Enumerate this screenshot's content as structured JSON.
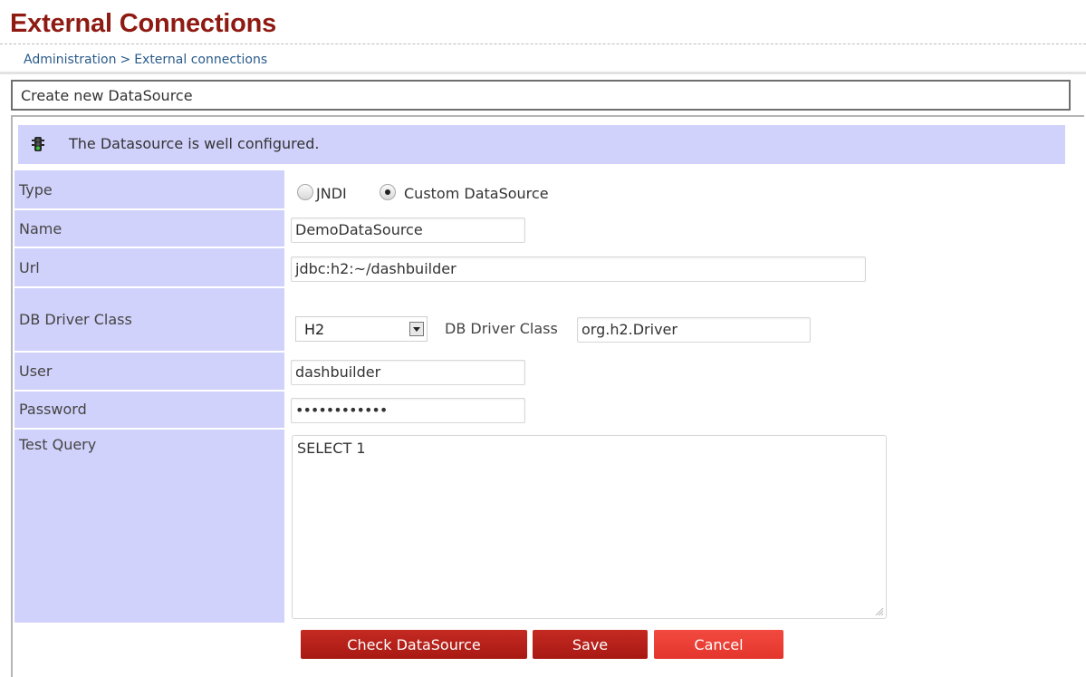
{
  "header": {
    "title": "External Connections"
  },
  "breadcrumb": {
    "items": [
      "Administration",
      "External connections"
    ],
    "separator": ">"
  },
  "section": {
    "title": "Create new DataSource"
  },
  "status": {
    "message": "The Datasource is well configured.",
    "icon": "traffic-light-icon",
    "color": "#d1d2fb"
  },
  "form": {
    "type": {
      "label": "Type",
      "options": [
        "JNDI",
        "Custom DataSource"
      ],
      "selected": "Custom DataSource"
    },
    "name": {
      "label": "Name",
      "value": "DemoDataSource"
    },
    "url": {
      "label": "Url",
      "value": "jdbc:h2:~/dashbuilder"
    },
    "driver": {
      "label": "DB Driver Class",
      "selected": "H2",
      "inline_label": "DB Driver Class",
      "class_value": "org.h2.Driver"
    },
    "user": {
      "label": "User",
      "value": "dashbuilder"
    },
    "password": {
      "label": "Password",
      "value": "••••••••••••"
    },
    "test_query": {
      "label": "Test Query",
      "value": "SELECT 1"
    }
  },
  "buttons": {
    "check": "Check DataSource",
    "save": "Save",
    "cancel": "Cancel"
  },
  "colors": {
    "title": "#8e1a12",
    "label_bg": "#d1d2fb",
    "button_dark": "#b0201a",
    "button_light": "#ea3f36"
  }
}
